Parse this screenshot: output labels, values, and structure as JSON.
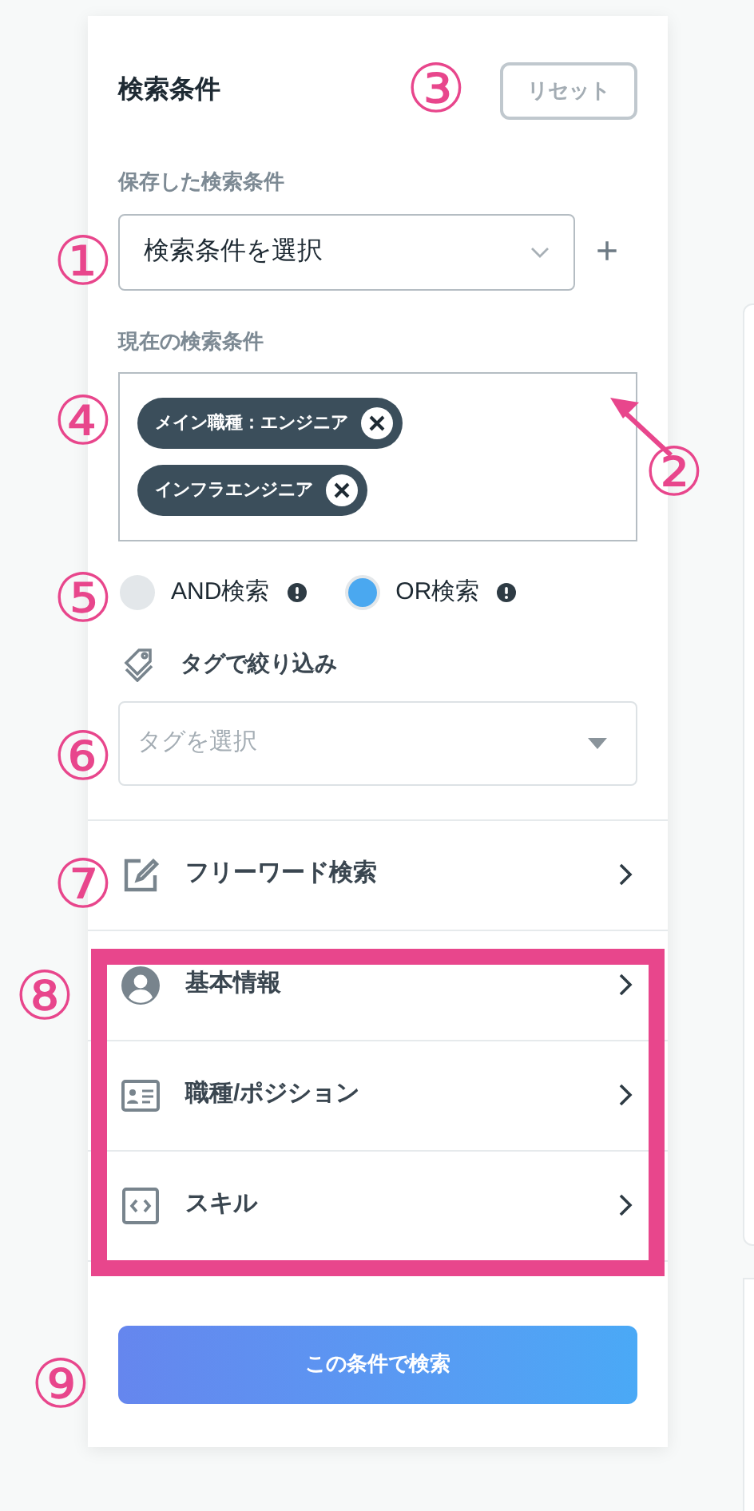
{
  "panel": {
    "title": "検索条件",
    "reset_button": "リセット",
    "saved_conditions": {
      "label": "保存した検索条件",
      "select": {
        "value": "検索条件を選択"
      },
      "add_button": "+"
    },
    "current_conditions": {
      "label": "現在の検索条件",
      "tags": [
        {
          "label": "メイン職種：エンジニア"
        },
        {
          "label": "インフラエンジニア"
        }
      ]
    },
    "search_mode": [
      {
        "label": "AND検索",
        "selected": false
      },
      {
        "label": "OR検索",
        "selected": true
      }
    ],
    "tag_filter": {
      "label": "タグで絞り込み",
      "select": {
        "placeholder": "タグを選択"
      }
    },
    "sections": [
      {
        "kind": "edit",
        "label": "フリーワード検索"
      },
      {
        "kind": "person",
        "label": "基本情報"
      },
      {
        "kind": "id-card",
        "label": "職種/ポジション"
      },
      {
        "kind": "code",
        "label": "スキル"
      }
    ],
    "search_button": "この条件で検索"
  },
  "annotations": [
    {
      "label": "①"
    },
    {
      "label": "②"
    },
    {
      "label": "③"
    },
    {
      "label": "④"
    },
    {
      "label": "⑤"
    },
    {
      "label": "⑥"
    },
    {
      "label": "⑦"
    },
    {
      "label": "⑧"
    },
    {
      "label": "⑨"
    }
  ]
}
